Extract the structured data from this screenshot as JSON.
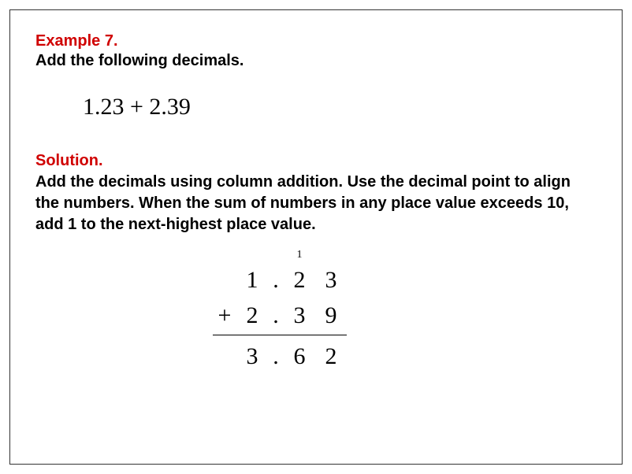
{
  "example": {
    "label": "Example 7.",
    "prompt": "Add the following decimals.",
    "expression": "1.23 + 2.39"
  },
  "solution": {
    "label": "Solution.",
    "text": "Add the decimals using column addition. Use the decimal point to align the numbers. When the sum of numbers in any place value exceeds 10, add 1 to the next-highest place value."
  },
  "columnAddition": {
    "carry": {
      "op": "",
      "c1": "",
      "dot": "",
      "c2": "1",
      "c3": ""
    },
    "row1": {
      "op": "",
      "c1": "1",
      "dot": ".",
      "c2": "2",
      "c3": "3"
    },
    "row2": {
      "op": "+",
      "c1": "2",
      "dot": ".",
      "c2": "3",
      "c3": "9"
    },
    "result": {
      "op": "",
      "c1": "3",
      "dot": ".",
      "c2": "6",
      "c3": "2"
    }
  }
}
